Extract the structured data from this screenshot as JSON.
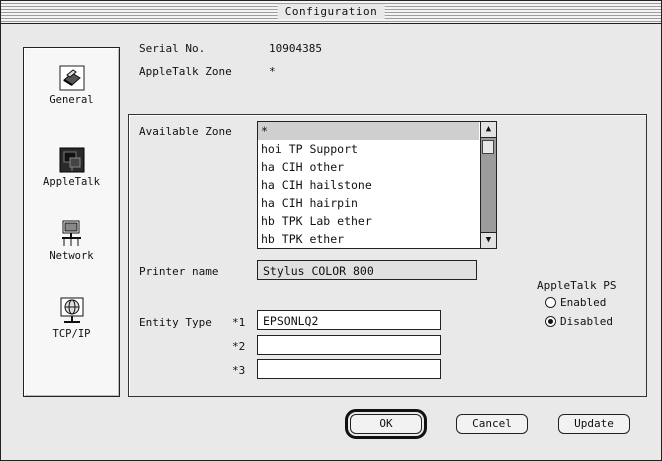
{
  "window": {
    "title": "Configuration"
  },
  "sidebar": {
    "items": [
      {
        "label": "General",
        "icon": "printer-icon"
      },
      {
        "label": "AppleTalk",
        "icon": "appletalk-icon"
      },
      {
        "label": "Network",
        "icon": "network-icon"
      },
      {
        "label": "TCP/IP",
        "icon": "globe-network-icon"
      }
    ]
  },
  "info": {
    "serial_label": "Serial No.",
    "serial_value": "10904385",
    "zone_label": "AppleTalk Zone",
    "zone_value": "*"
  },
  "available_zone": {
    "label": "Available Zone",
    "items": [
      "*",
      "hoi TP Support",
      "ha CIH other",
      "ha CIH hailstone",
      "ha CIH hairpin",
      "hb TPK Lab ether",
      "hb TPK ether"
    ],
    "selected_index": 0
  },
  "printer": {
    "label": "Printer name",
    "value": "Stylus COLOR 800"
  },
  "entity": {
    "label": "Entity Type",
    "rows": [
      {
        "num": "*1",
        "value": "EPSONLQ2"
      },
      {
        "num": "*2",
        "value": ""
      },
      {
        "num": "*3",
        "value": ""
      }
    ]
  },
  "appletalk_ps": {
    "label": "AppleTalk PS",
    "options": [
      "Enabled",
      "Disabled"
    ],
    "selected": "Disabled"
  },
  "buttons": {
    "ok": "OK",
    "cancel": "Cancel",
    "update": "Update"
  }
}
